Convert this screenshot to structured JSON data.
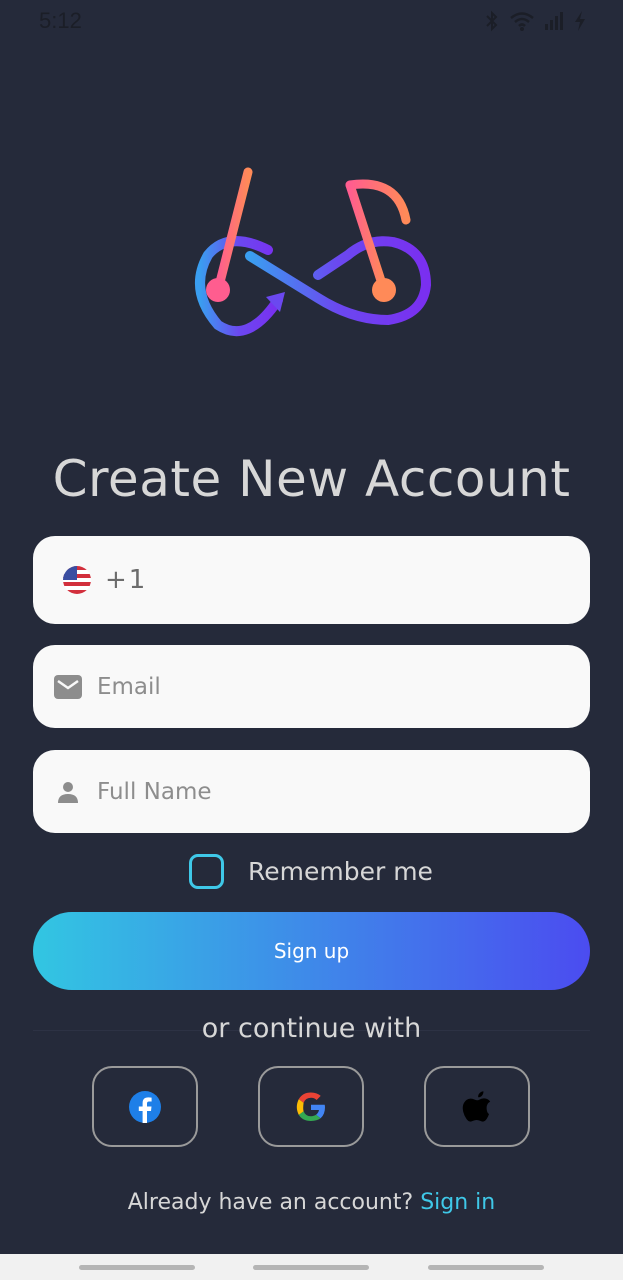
{
  "status_bar": {
    "time": "5:12"
  },
  "title": "Create New Account",
  "phone_field": {
    "country_code": "+1"
  },
  "email_field": {
    "placeholder": "Email"
  },
  "name_field": {
    "placeholder": "Full Name"
  },
  "remember": {
    "label": "Remember me",
    "checked": false
  },
  "signup_button": {
    "label": "Sign up"
  },
  "divider_text": "or continue with",
  "social": [
    {
      "name": "facebook-icon"
    },
    {
      "name": "google-icon"
    },
    {
      "name": "apple-icon"
    }
  ],
  "footer": {
    "prompt": "Already have an account?",
    "link": "Sign in"
  },
  "colors": {
    "background": "#252a3a",
    "accent": "#3fc8e8",
    "gradient_start": "#32c6e2",
    "gradient_end": "#4b4cf0",
    "field_bg": "#f9f9f9"
  }
}
